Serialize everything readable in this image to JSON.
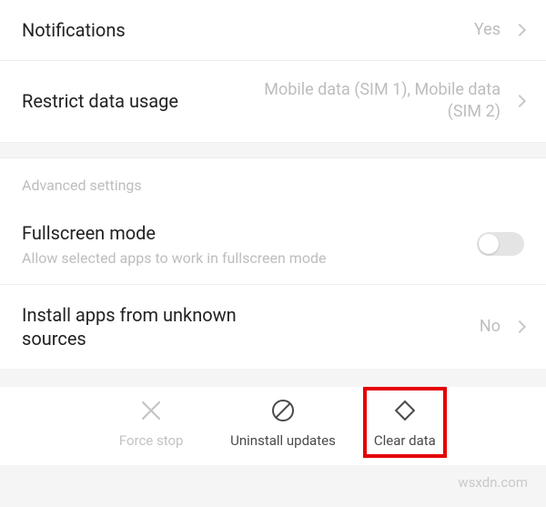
{
  "rows": {
    "notifications": {
      "label": "Notifications",
      "value": "Yes"
    },
    "restrict": {
      "label": "Restrict data usage",
      "value": "Mobile data (SIM 1), Mobile data (SIM 2)"
    },
    "sectionHeader": "Advanced settings",
    "fullscreen": {
      "label": "Fullscreen mode",
      "sub": "Allow selected apps to work in fullscreen mode"
    },
    "unknown": {
      "label": "Install apps from unknown sources",
      "value": "No"
    }
  },
  "actions": {
    "forceStop": "Force stop",
    "uninstall": "Uninstall updates",
    "clearData": "Clear data"
  },
  "watermark": "wsxdn.com"
}
